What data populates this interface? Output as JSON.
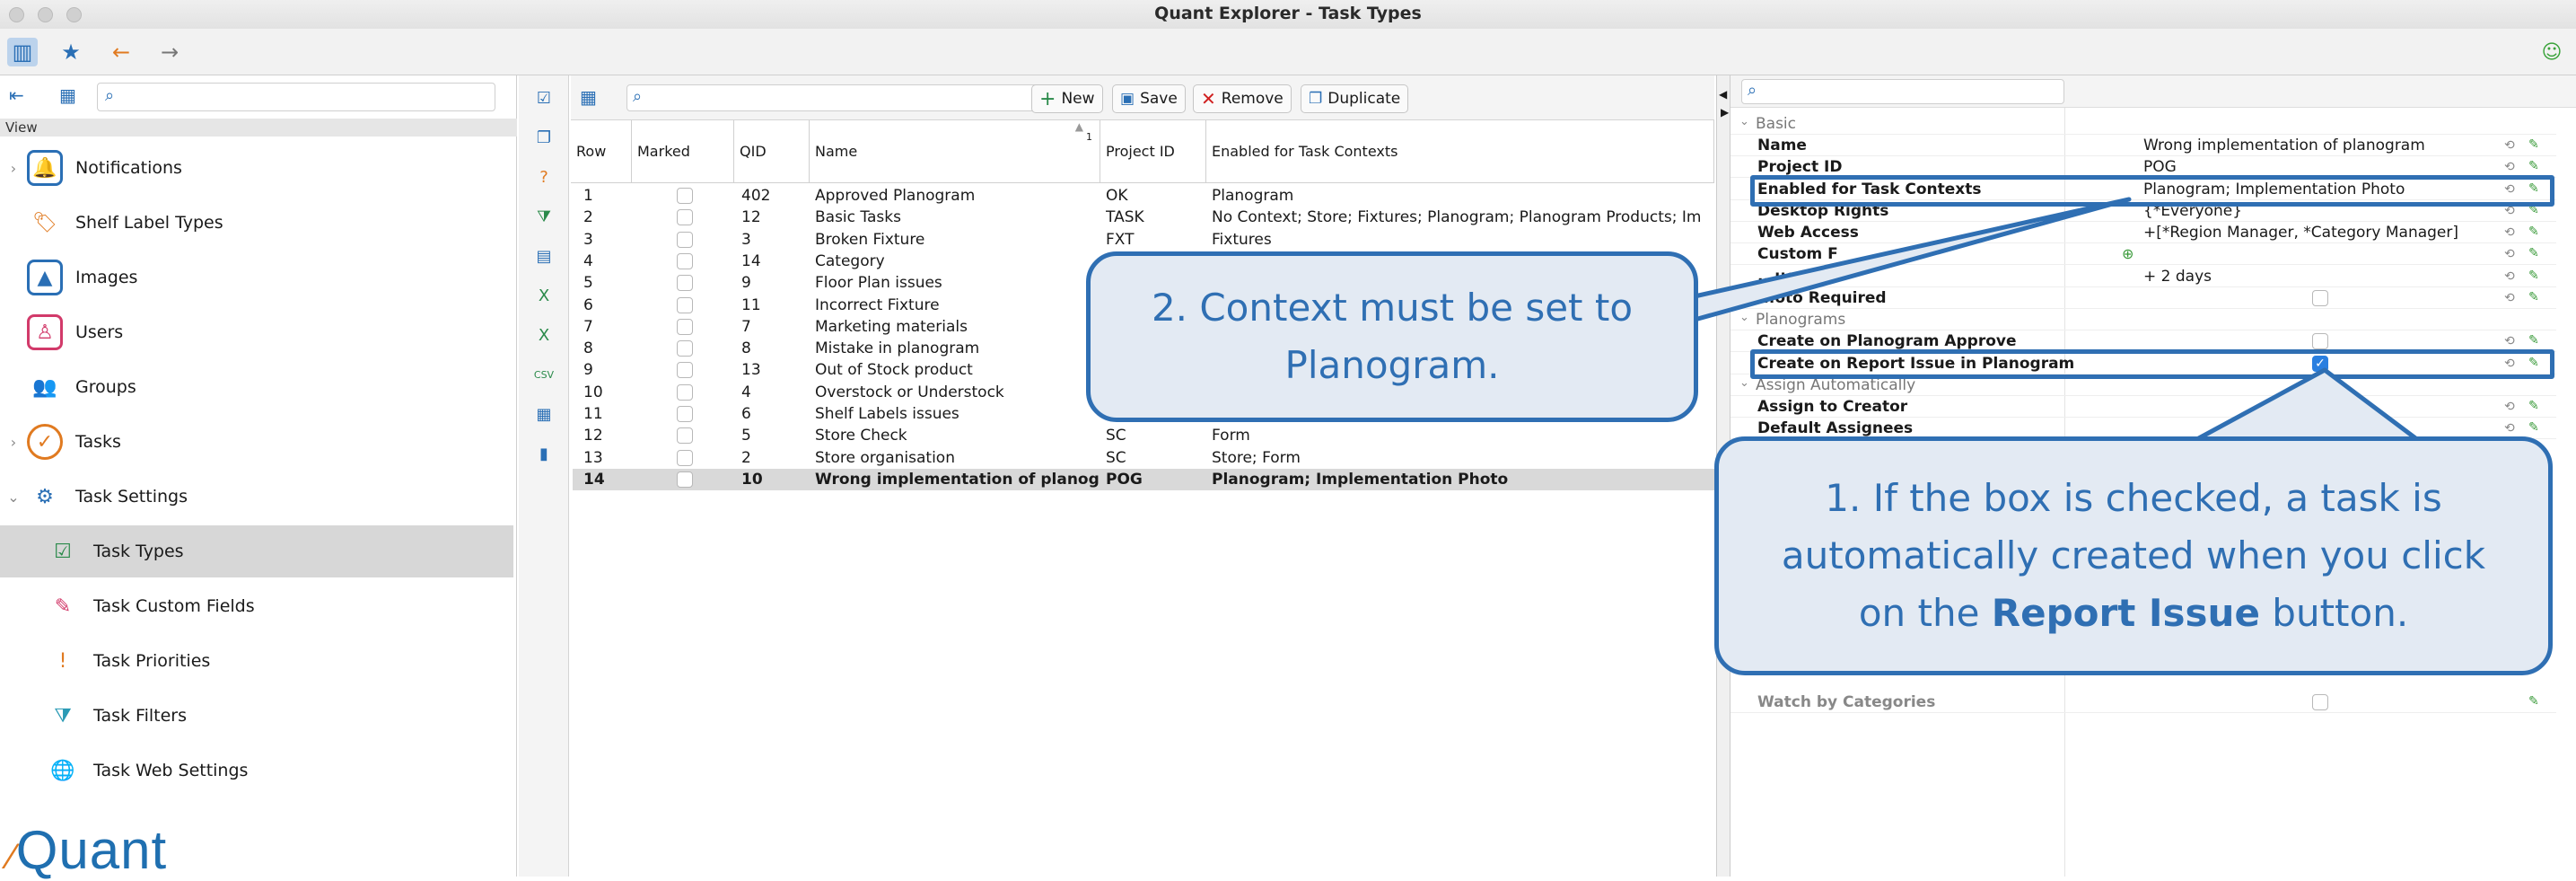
{
  "window": {
    "title": "Quant Explorer - Task Types"
  },
  "left_panel": {
    "view_label": "View",
    "nav": [
      {
        "label": "Notifications",
        "icon": "bell-icon",
        "expandable": true
      },
      {
        "label": "Shelf Label Types",
        "icon": "shelf-label-icon",
        "expandable": false
      },
      {
        "label": "Images",
        "icon": "image-icon",
        "expandable": false
      },
      {
        "label": "Users",
        "icon": "user-icon",
        "expandable": false
      },
      {
        "label": "Groups",
        "icon": "group-icon",
        "expandable": false
      },
      {
        "label": "Tasks",
        "icon": "task-check-icon",
        "expandable": true
      },
      {
        "label": "Task Settings",
        "icon": "task-settings-icon",
        "expanded": true
      },
      {
        "label": "Task Types",
        "icon": "task-types-icon",
        "selected": true
      },
      {
        "label": "Task Custom Fields",
        "icon": "task-custom-fields-icon"
      },
      {
        "label": "Task Priorities",
        "icon": "task-priorities-icon"
      },
      {
        "label": "Task Filters",
        "icon": "task-filters-icon"
      },
      {
        "label": "Task Web Settings",
        "icon": "task-web-settings-icon"
      }
    ],
    "logo_text": "Quant"
  },
  "toolbar": {
    "new_label": "New",
    "save_label": "Save",
    "remove_label": "Remove",
    "duplicate_label": "Duplicate"
  },
  "table": {
    "columns": [
      "Row",
      "Marked",
      "QID",
      "Name",
      "Project ID",
      "Enabled for Task Contexts"
    ],
    "sort_indicator": "1",
    "rows": [
      {
        "row": "1",
        "qid": "402",
        "name": "Approved Planogram",
        "project_id": "OK",
        "contexts": "Planogram"
      },
      {
        "row": "2",
        "qid": "12",
        "name": "Basic Tasks",
        "project_id": "TASK",
        "contexts": "No Context; Store; Fixtures; Planogram; Planogram Products; Im"
      },
      {
        "row": "3",
        "qid": "3",
        "name": "Broken Fixture",
        "project_id": "FXT",
        "contexts": "Fixtures"
      },
      {
        "row": "4",
        "qid": "14",
        "name": "Category",
        "project_id": "",
        "contexts": ""
      },
      {
        "row": "5",
        "qid": "9",
        "name": "Floor Plan issues",
        "project_id": "",
        "contexts": ""
      },
      {
        "row": "6",
        "qid": "11",
        "name": "Incorrect Fixture",
        "project_id": "",
        "contexts": ""
      },
      {
        "row": "7",
        "qid": "7",
        "name": "Marketing materials",
        "project_id": "",
        "contexts": ""
      },
      {
        "row": "8",
        "qid": "8",
        "name": "Mistake in planogram",
        "project_id": "",
        "contexts": ""
      },
      {
        "row": "9",
        "qid": "13",
        "name": "Out of Stock product",
        "project_id": "",
        "contexts": ""
      },
      {
        "row": "10",
        "qid": "4",
        "name": "Overstock or Understock",
        "project_id": "",
        "contexts": ""
      },
      {
        "row": "11",
        "qid": "6",
        "name": "Shelf Labels issues",
        "project_id": "",
        "contexts": ""
      },
      {
        "row": "12",
        "qid": "5",
        "name": "Store Check",
        "project_id": "SC",
        "contexts": "Form"
      },
      {
        "row": "13",
        "qid": "2",
        "name": "Store organisation",
        "project_id": "SC",
        "contexts": "Store; Form"
      },
      {
        "row": "14",
        "qid": "10",
        "name": "Wrong implementation of planogram",
        "project_id": "POG",
        "contexts": "Planogram; Implementation Photo",
        "selected": true
      }
    ]
  },
  "properties": {
    "sections": {
      "basic": "Basic",
      "planograms": "Planograms",
      "assign": "Assign Automatically"
    },
    "name_label": "Name",
    "name_value": "Wrong implementation of planogram",
    "project_label": "Project ID",
    "project_value": "POG",
    "contexts_label": "Enabled for Task Contexts",
    "contexts_value": "Planogram; Implementation Photo",
    "desktop_rights_label": "Desktop Rights",
    "desktop_rights_value": "{*Everyone}",
    "web_access_label": "Web Access",
    "web_access_value": "+[*Region Manager, *Category Manager]",
    "custom_fields_label": "Custom F",
    "due_date_label": "...ue Date",
    "due_date_value": "+ 2 days",
    "photo_required_label": "...oto Required",
    "create_on_approve_label": "Create on Planogram Approve",
    "create_on_report_label": "Create on Report Issue in Planogram",
    "create_on_report_checked": true,
    "assign_creator_label": "Assign to Creator",
    "default_assignees_label": "Default Assignees",
    "watch_categories_label": "Watch by Categories"
  },
  "callouts": {
    "context_note": "2. Context must be set to Planogram.",
    "checkbox_note_pre": "1. If the box is checked, a task is automatically created when you click on the ",
    "checkbox_note_bold": "Report Issue",
    "checkbox_note_post": " button."
  },
  "colors": {
    "accent": "#2f6fb3",
    "callout_bg": "#e3eaf3",
    "selection": "#d9d9d9"
  }
}
